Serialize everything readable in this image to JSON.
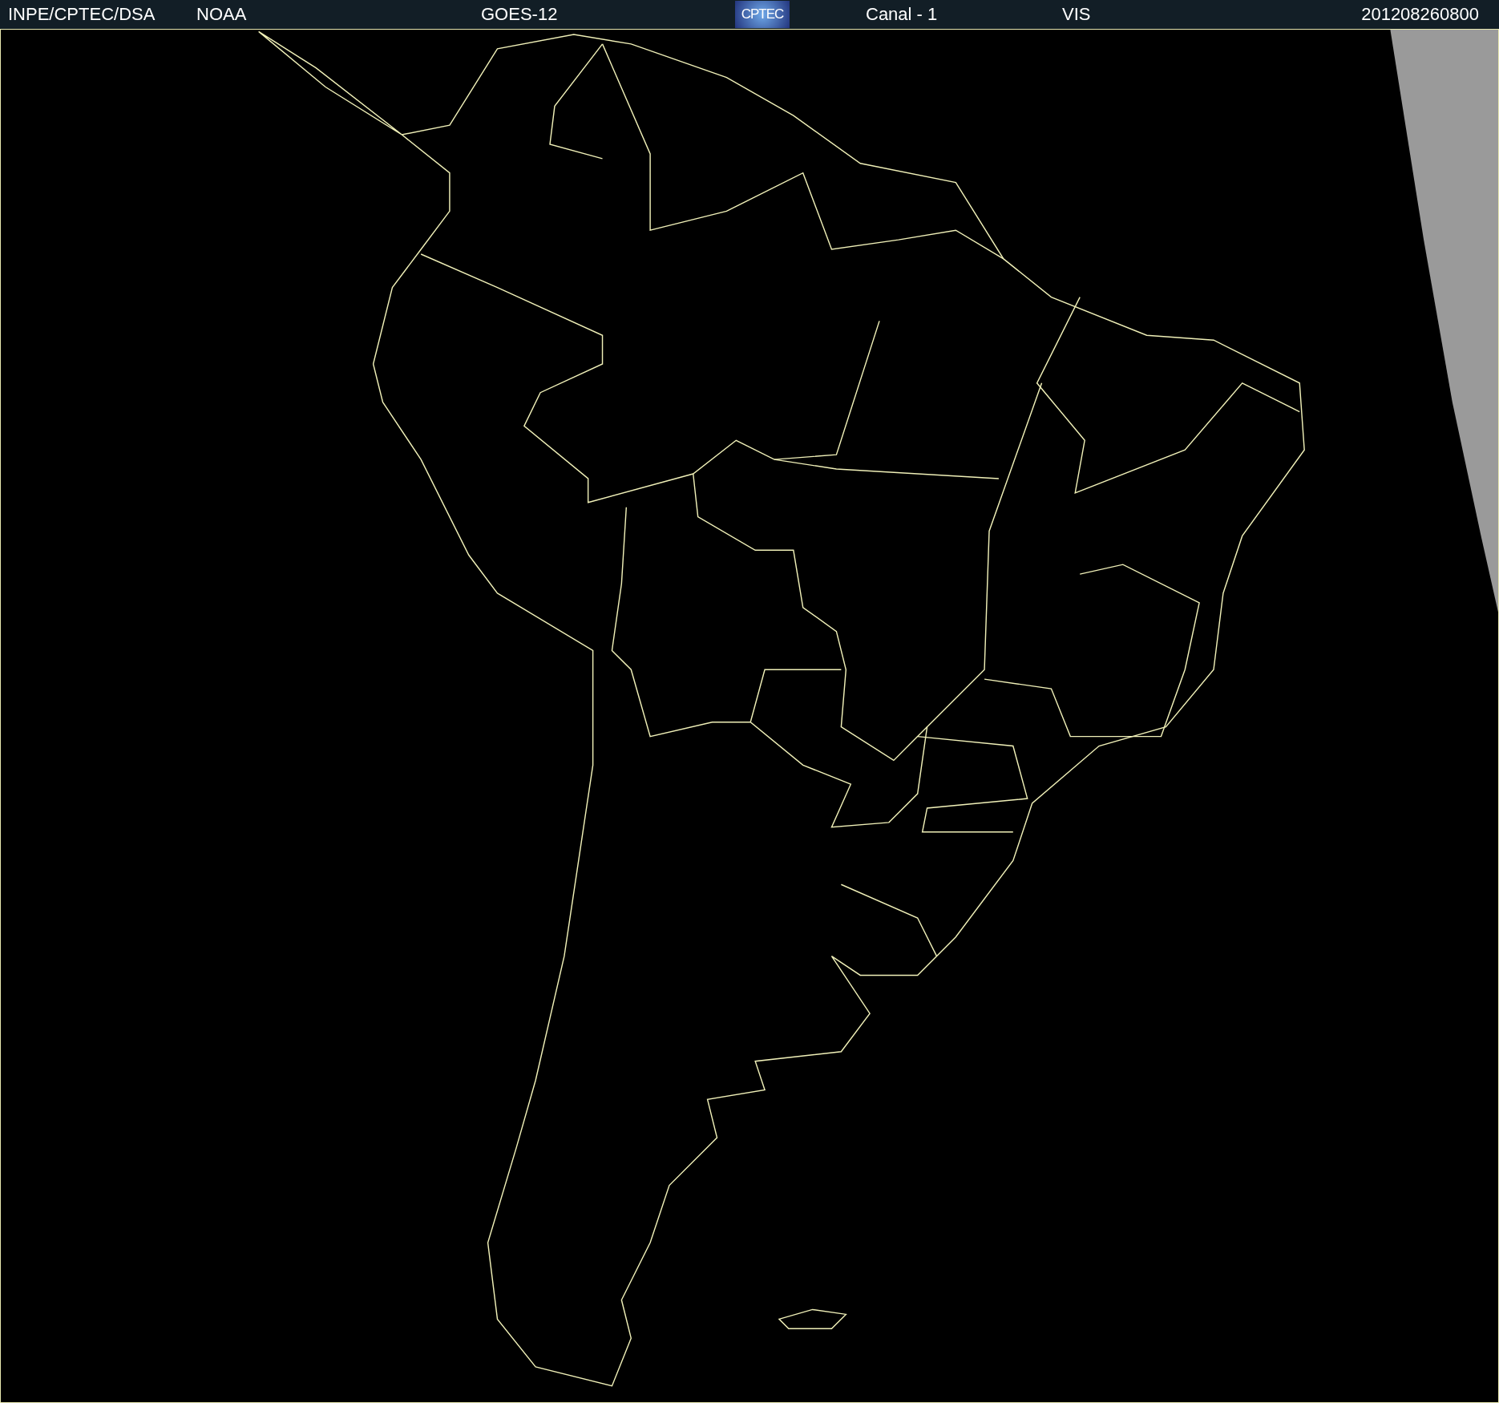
{
  "header": [
    {
      "kind": "text",
      "text": "INPE/CPTEC/DSA"
    },
    {
      "kind": "text",
      "text": "NOAA"
    },
    {
      "kind": "text",
      "text": "GOES-12"
    },
    {
      "kind": "logo",
      "text": "CPTEC"
    },
    {
      "kind": "text",
      "text": "Canal - 1"
    },
    {
      "kind": "text",
      "text": "VIS"
    },
    {
      "kind": "text",
      "text": "201208260800"
    }
  ]
}
